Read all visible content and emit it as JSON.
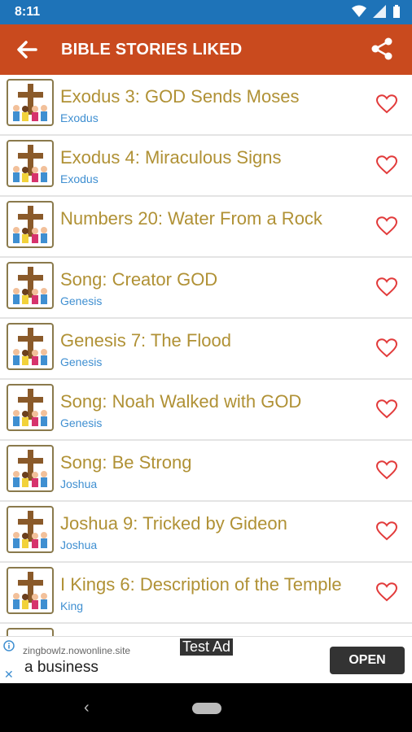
{
  "status": {
    "time": "8:11"
  },
  "appbar": {
    "title": "BIBLE STORIES LIKED"
  },
  "stories": [
    {
      "title": "Exodus 3: GOD Sends Moses",
      "book": "Exodus"
    },
    {
      "title": "Exodus 4: Miraculous Signs",
      "book": "Exodus"
    },
    {
      "title": "Numbers 20: Water From a Rock",
      "book": ""
    },
    {
      "title": "Song: Creator GOD",
      "book": "Genesis"
    },
    {
      "title": "Genesis 7: The Flood",
      "book": "Genesis"
    },
    {
      "title": "Song: Noah Walked with GOD",
      "book": "Genesis"
    },
    {
      "title": "Song: Be Strong",
      "book": "Joshua"
    },
    {
      "title": "Joshua 9: Tricked by Gideon",
      "book": "Joshua"
    },
    {
      "title": "I Kings 6: Description of the Temple",
      "book": "King"
    }
  ],
  "ad": {
    "site": "zingbowlz.nowonline.site",
    "text": "a business",
    "label": "Test Ad",
    "button": "OPEN"
  },
  "colors": {
    "appbar": "#c94a1e",
    "statusbar": "#1e73b8",
    "title": "#b09135",
    "subtitle": "#3f8fd1",
    "heart": "#e23b3b"
  }
}
